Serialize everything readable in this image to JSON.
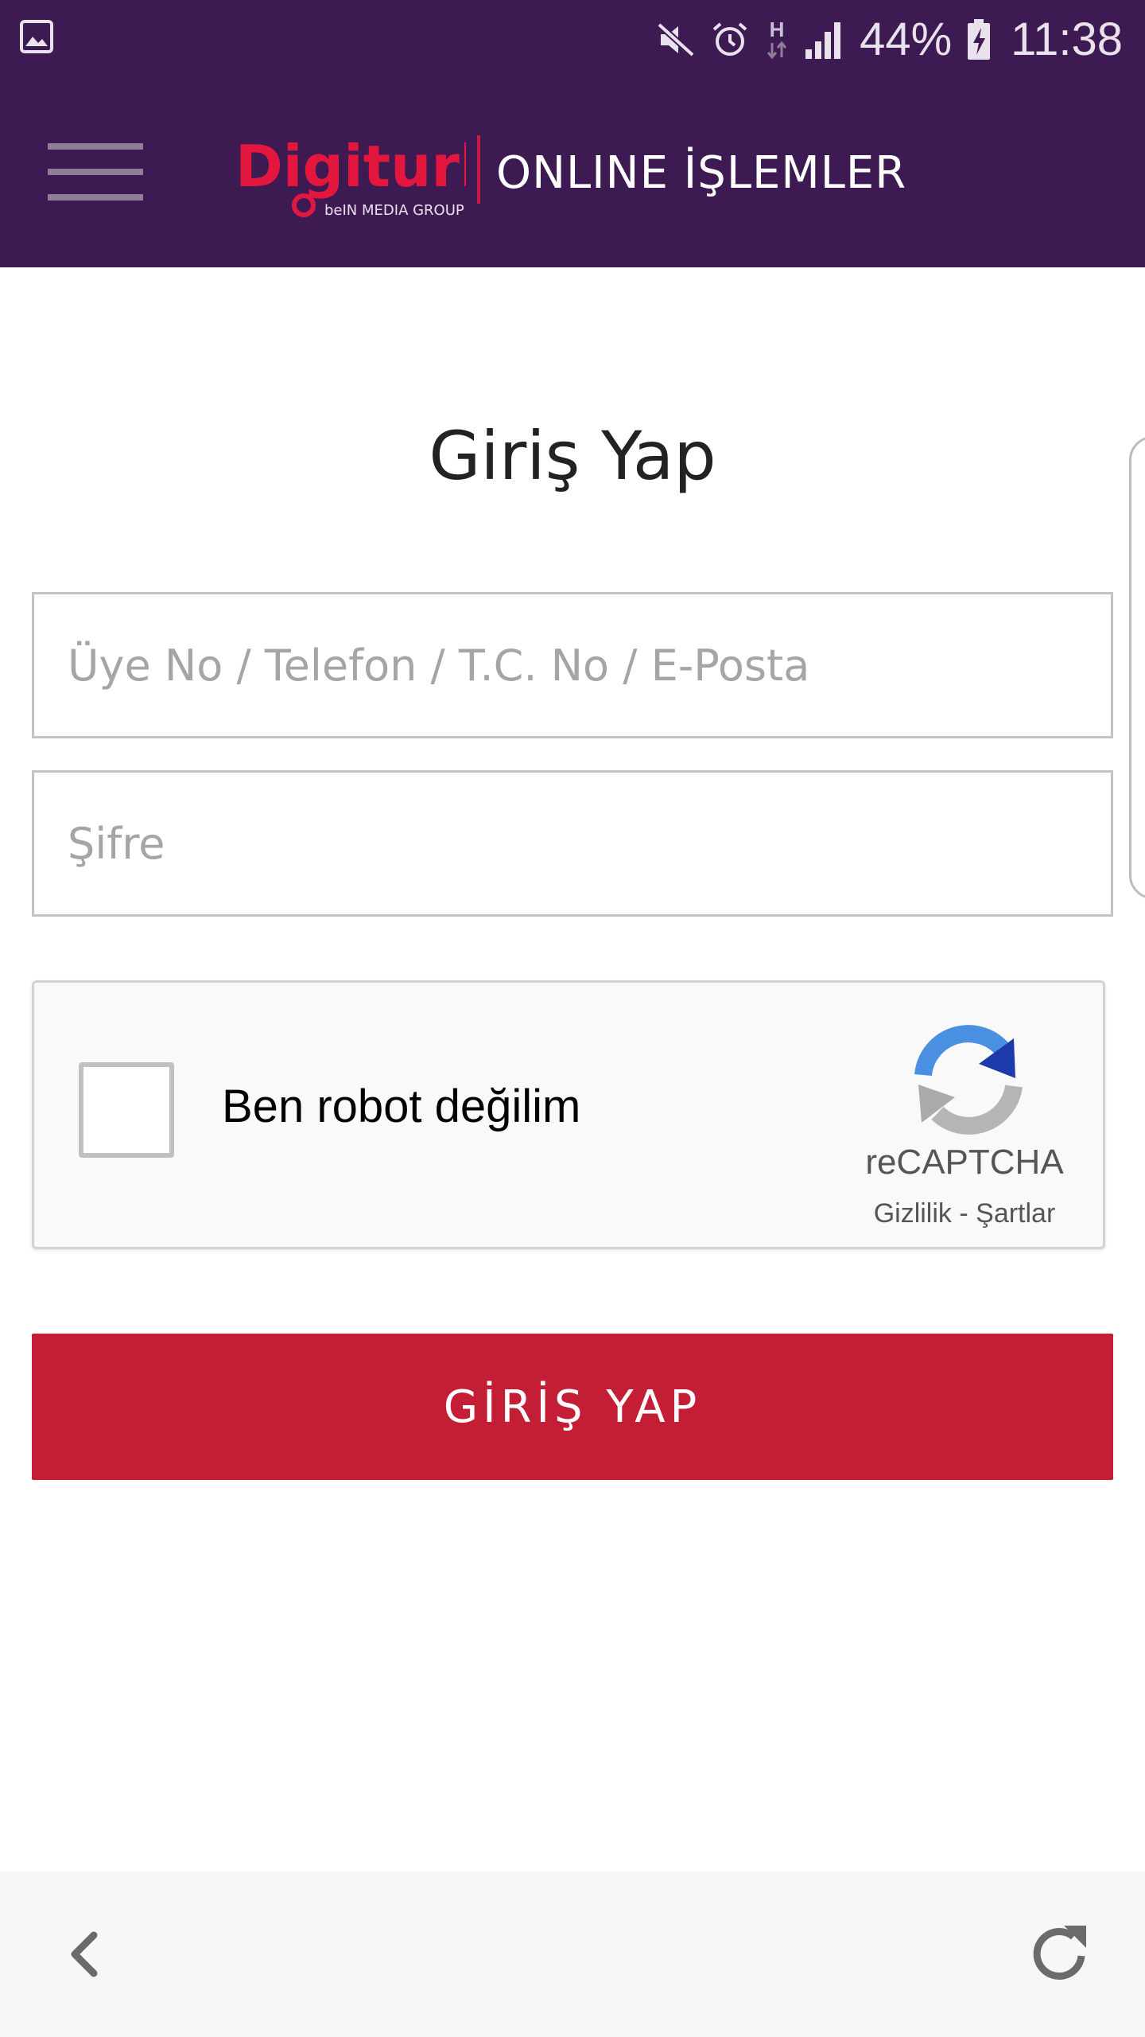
{
  "status_bar": {
    "battery": "44%",
    "time": "11:38",
    "network_type": "H",
    "icons": [
      "gallery-icon",
      "mute-icon",
      "alarm-icon",
      "network-type-icon",
      "signal-icon",
      "battery-charging-icon"
    ]
  },
  "app_bar": {
    "title": "ONLINE İŞLEMLER",
    "logo_text": "Digiturk",
    "logo_subtext": "beIN MEDIA GROUP",
    "menu_icon": "hamburger-menu-icon"
  },
  "login": {
    "title": "Giriş Yap",
    "username_placeholder": "Üye No / Telefon / T.C. No / E-Posta",
    "password_placeholder": "Şifre",
    "button_label": "GİRİŞ YAP"
  },
  "recaptcha": {
    "label": "Ben robot değilim",
    "brand": "reCAPTCHA",
    "privacy": "Gizlilik",
    "separator": " - ",
    "terms": "Şartlar"
  },
  "browser_bar": {
    "back_icon": "chevron-left-icon",
    "reload_icon": "reload-icon"
  },
  "colors": {
    "header_bg": "#3d1a51",
    "brand_red": "#c31e35",
    "recaptcha_bg": "#f9f9f9",
    "bottom_bar_bg": "#f7f7f7"
  }
}
